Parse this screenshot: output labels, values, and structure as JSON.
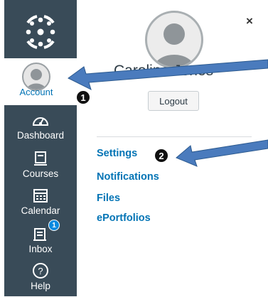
{
  "global_nav": {
    "account_label": "Account",
    "items": [
      {
        "label": "Dashboard",
        "icon": "dashboard-gauge-icon"
      },
      {
        "label": "Courses",
        "icon": "courses-book-icon"
      },
      {
        "label": "Calendar",
        "icon": "calendar-icon"
      },
      {
        "label": "Inbox",
        "icon": "inbox-icon",
        "badge": "1"
      },
      {
        "label": "Help",
        "icon": "help-question-icon"
      }
    ]
  },
  "account_tray": {
    "close_label": "×",
    "user_name": "Caroline Jones",
    "logout_label": "Logout",
    "links": [
      "Settings",
      "Notifications",
      "Files",
      "ePortfolios"
    ]
  },
  "annotations": {
    "marker_1": "1",
    "marker_2": "2",
    "arrow_color": "#4a7bbd"
  },
  "colors": {
    "nav_background": "#394b58",
    "link_blue": "#0374b5"
  }
}
